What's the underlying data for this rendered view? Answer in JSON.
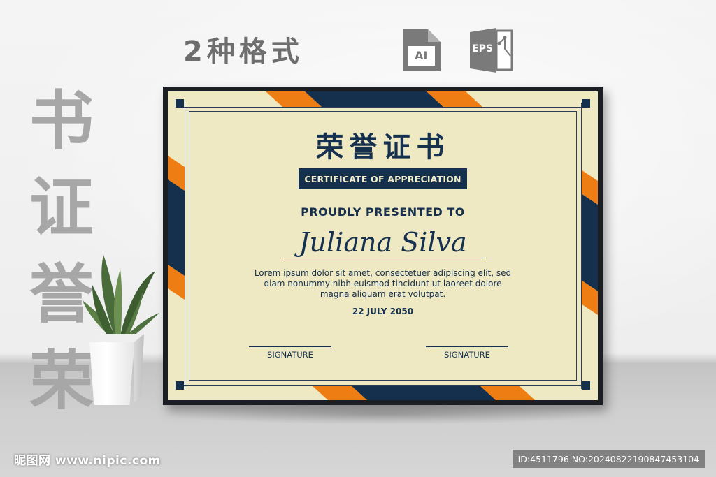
{
  "headline": "2种格式",
  "formats": [
    {
      "label": "AI",
      "icon": "ai-file-icon"
    },
    {
      "label": "EPS",
      "icon": "eps-file-icon"
    }
  ],
  "vertical_title": [
    "书",
    "证",
    "誉",
    "荣"
  ],
  "certificate": {
    "title": "荣誉证书",
    "banner": "CERTIFICATE OF APPRECIATION",
    "presented": "PROUDLY PRESENTED TO",
    "recipient": "Juliana Silva",
    "body_lines": [
      "Lorem ipsum dolor sit amet, consectetuer adipiscing elit, sed",
      "diam nonummy nibh euismod tincidunt ut laoreet dolore",
      "magna aliquam erat volutpat."
    ],
    "date": "22 JULY 2050",
    "signature_left": "SIGNATURE",
    "signature_right": "SIGNATURE"
  },
  "colors": {
    "navy": "#14304d",
    "orange": "#ee7d14",
    "paper": "#efe9c3",
    "frame": "#1b1f24"
  },
  "watermark": {
    "site": "昵图网 www.nipic.com",
    "id": "ID:4511796 NO:20240822190847453104"
  }
}
